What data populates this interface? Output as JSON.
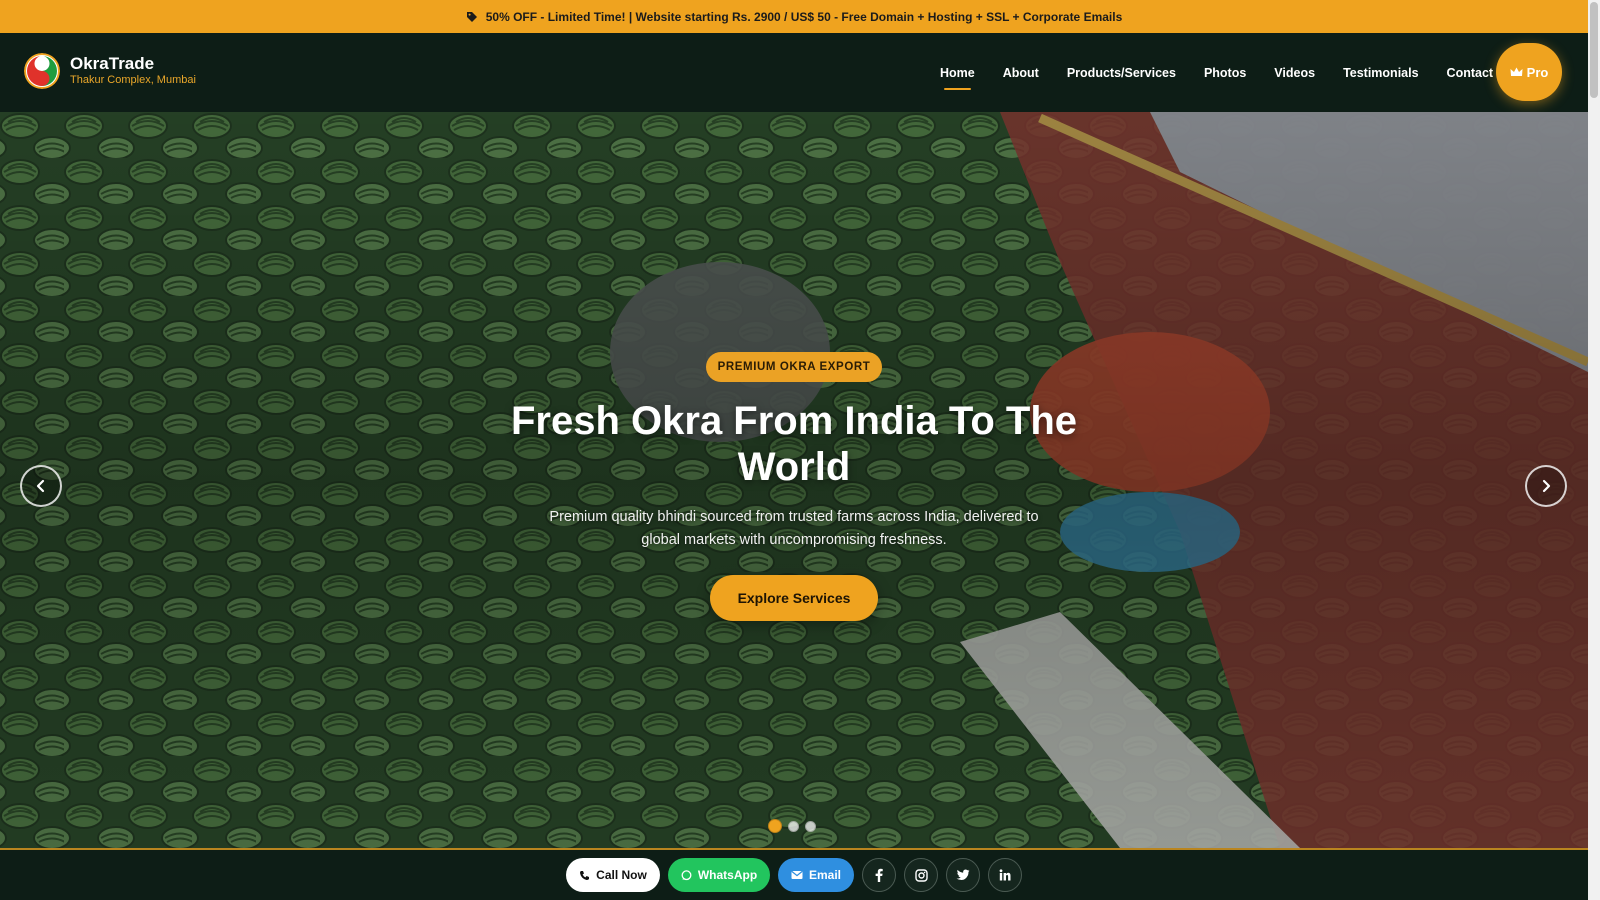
{
  "promo": {
    "text": "50% OFF - Limited Time! | Website starting Rs. 2900 / US$ 50 - Free Domain + Hosting + SSL + Corporate Emails",
    "icon": "tag-icon"
  },
  "header": {
    "brand_name": "OkraTrade",
    "brand_location": "Thakur Complex, Mumbai",
    "nav": [
      {
        "label": "Home",
        "active": true
      },
      {
        "label": "About"
      },
      {
        "label": "Products/Services"
      },
      {
        "label": "Photos"
      },
      {
        "label": "Videos"
      },
      {
        "label": "Testimonials"
      },
      {
        "label": "Contact"
      }
    ],
    "pro_label": "Pro",
    "pro_icon": "crown-icon"
  },
  "hero": {
    "badge": "PREMIUM OKRA EXPORT",
    "title": "Fresh Okra From India To The World",
    "subtitle": "Premium quality bhindi sourced from trusted farms across India, delivered to global markets with uncompromising freshness.",
    "cta": "Explore Services",
    "slide_count": 3,
    "active_slide": 1
  },
  "contact_bar": {
    "call_label": "Call Now",
    "whatsapp_label": "WhatsApp",
    "email_label": "Email",
    "socials": [
      "facebook-icon",
      "instagram-icon",
      "twitter-icon",
      "linkedin-icon"
    ]
  },
  "colors": {
    "accent": "#efa31f",
    "dark": "#0d1d16",
    "whatsapp": "#22c55e",
    "email": "#2f8fe0"
  }
}
